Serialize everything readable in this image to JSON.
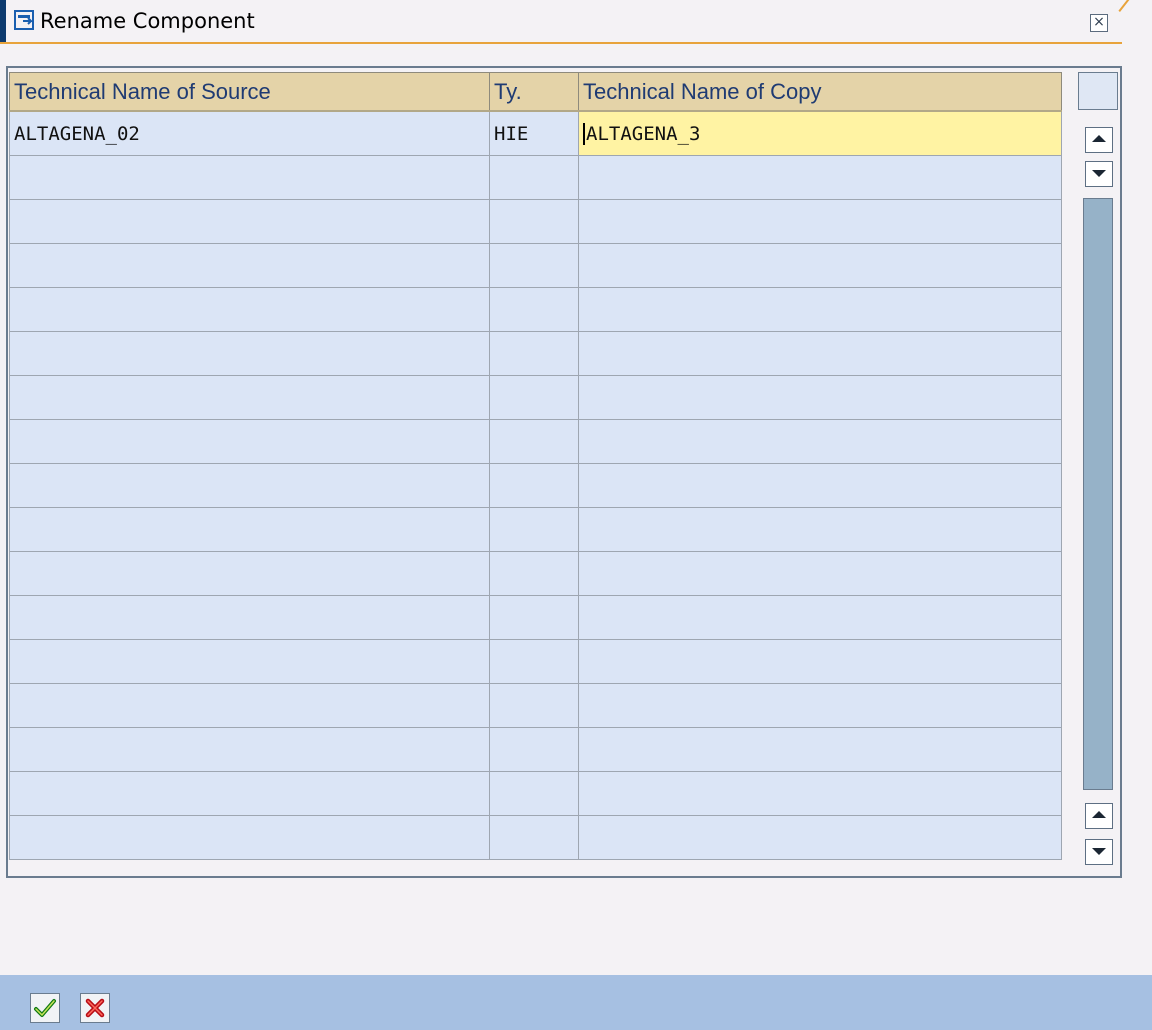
{
  "window": {
    "title": "Rename Component",
    "close_glyph": "×",
    "accent_color": "#e8a33b"
  },
  "table": {
    "columns": [
      {
        "label": "Technical Name of Source"
      },
      {
        "label": "Ty."
      },
      {
        "label": "Technical Name of Copy"
      }
    ],
    "rows": [
      {
        "source": "ALTAGENA_02",
        "type": "HIE",
        "copy": "ALTAGENA_3"
      }
    ],
    "empty_row_count": 16
  },
  "toolbar": {
    "confirm_icon": "checkmark-icon",
    "cancel_icon": "cancel-x-icon"
  }
}
